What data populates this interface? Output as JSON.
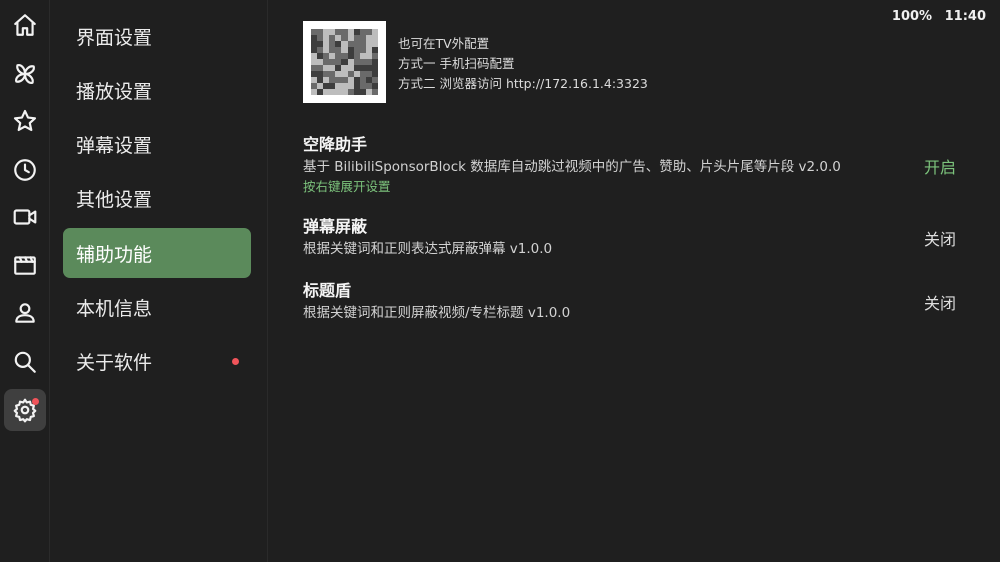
{
  "status_bar": {
    "battery": "100%",
    "time": "11:40"
  },
  "rail": {
    "items": [
      {
        "name": "home-icon"
      },
      {
        "name": "pinwheel-icon"
      },
      {
        "name": "star-icon"
      },
      {
        "name": "clock-icon"
      },
      {
        "name": "video-camera-icon"
      },
      {
        "name": "clapperboard-icon"
      },
      {
        "name": "user-icon"
      },
      {
        "name": "search-icon"
      },
      {
        "name": "gear-icon",
        "active": true,
        "badge": true
      }
    ]
  },
  "menu": {
    "items": [
      {
        "label": "界面设置"
      },
      {
        "label": "播放设置"
      },
      {
        "label": "弹幕设置"
      },
      {
        "label": "其他设置"
      },
      {
        "label": "辅助功能",
        "active": true
      },
      {
        "label": "本机信息"
      },
      {
        "label": "关于软件",
        "badge": true
      }
    ]
  },
  "qr_info": {
    "line1": "也可在TV外配置",
    "line2": "方式一 手机扫码配置",
    "line3": "方式二 浏览器访问 http://172.16.1.4:3323"
  },
  "features": [
    {
      "title": "空降助手",
      "description": "基于 BilibiliSponsorBlock 数据库自动跳过视频中的广告、赞助、片头片尾等片段  v2.0.0",
      "hint": "按右键展开设置",
      "state": "开启",
      "enabled": true
    },
    {
      "title": "弹幕屏蔽",
      "description": "根据关键词和正则表达式屏蔽弹幕  v1.0.0",
      "state": "关闭",
      "enabled": false
    },
    {
      "title": "标题盾",
      "description": "根据关键词和正则屏蔽视频/专栏标题  v1.0.0",
      "state": "关闭",
      "enabled": false
    }
  ],
  "colors": {
    "accent": "#5b8a5b",
    "on_state": "#7cc37c",
    "badge": "#f0545a",
    "background": "#1f1f1f"
  }
}
